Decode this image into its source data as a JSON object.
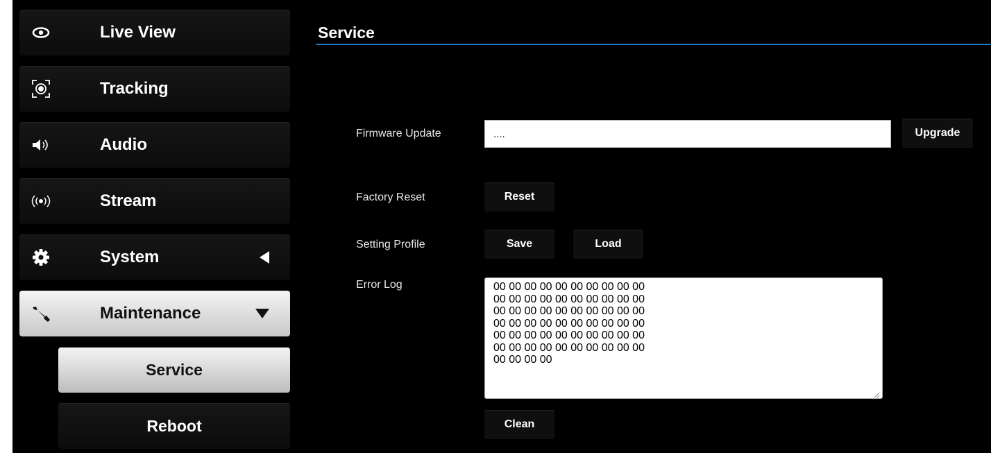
{
  "sidebar": {
    "items": [
      {
        "label": "Live View",
        "icon": "eye-icon"
      },
      {
        "label": "Tracking",
        "icon": "tracking-icon"
      },
      {
        "label": "Audio",
        "icon": "speaker-icon"
      },
      {
        "label": "Stream",
        "icon": "broadcast-icon"
      },
      {
        "label": "System",
        "icon": "gear-icon"
      },
      {
        "label": "Maintenance",
        "icon": "wrench-icon"
      }
    ],
    "subitems": [
      {
        "label": "Service"
      },
      {
        "label": "Reboot"
      }
    ]
  },
  "main": {
    "title": "Service",
    "firmware": {
      "label": "Firmware Update",
      "value": "....",
      "button": "Upgrade"
    },
    "factory_reset": {
      "label": "Factory Reset",
      "button": "Reset"
    },
    "setting_profile": {
      "label": "Setting Profile",
      "save": "Save",
      "load": "Load"
    },
    "error_log": {
      "label": "Error Log",
      "lines": [
        "00 00 00 00 00 00 00 00 00 00",
        "00 00 00 00 00 00 00 00 00 00",
        "00 00 00 00 00 00 00 00 00 00",
        "00 00 00 00 00 00 00 00 00 00",
        "00 00 00 00 00 00 00 00 00 00",
        "00 00 00 00 00 00 00 00 00 00",
        "00 00 00 00"
      ],
      "button": "Clean"
    }
  },
  "colors": {
    "accent": "#1f78c4",
    "background": "#000000"
  }
}
